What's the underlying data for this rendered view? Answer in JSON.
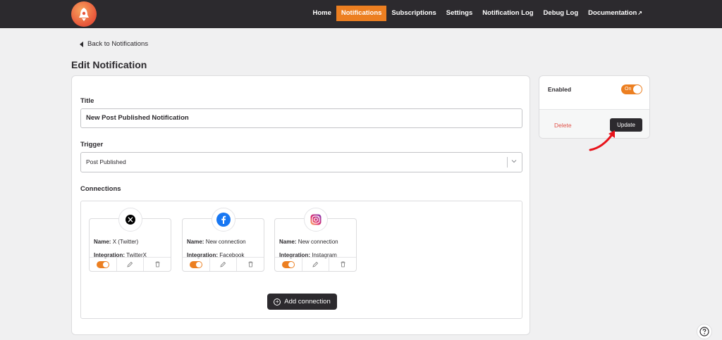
{
  "nav": {
    "items": [
      "Home",
      "Notifications",
      "Subscriptions",
      "Settings",
      "Notification Log",
      "Debug Log",
      "Documentation"
    ],
    "active": "Notifications",
    "external_icon": "external-link-icon"
  },
  "back_link": "Back to Notifications",
  "page_title": "Edit Notification",
  "form": {
    "title_label": "Title",
    "title_value": "New Post Published Notification",
    "trigger_label": "Trigger",
    "trigger_value": "Post Published",
    "connections_label": "Connections"
  },
  "connections": [
    {
      "icon": "x-twitter-icon",
      "name_label": "Name:",
      "name": "X (Twitter)",
      "integration_label": "Integration:",
      "integration": "TwitterX",
      "enabled": true
    },
    {
      "icon": "facebook-icon",
      "name_label": "Name:",
      "name": "New connection",
      "integration_label": "Integration:",
      "integration": "Facebook",
      "enabled": true
    },
    {
      "icon": "instagram-icon",
      "name_label": "Name:",
      "name": "New connection",
      "integration_label": "Integration:",
      "integration": "Instagram",
      "enabled": true
    }
  ],
  "add_connection_label": "Add connection",
  "sidebar": {
    "enabled_label": "Enabled",
    "toggle_text": "On",
    "delete_label": "Delete",
    "update_label": "Update"
  },
  "colors": {
    "accent": "#ec7f21",
    "topbar": "#2c2a2e",
    "delete": "#e0534a",
    "annotation_arrow": "#e8131b"
  }
}
